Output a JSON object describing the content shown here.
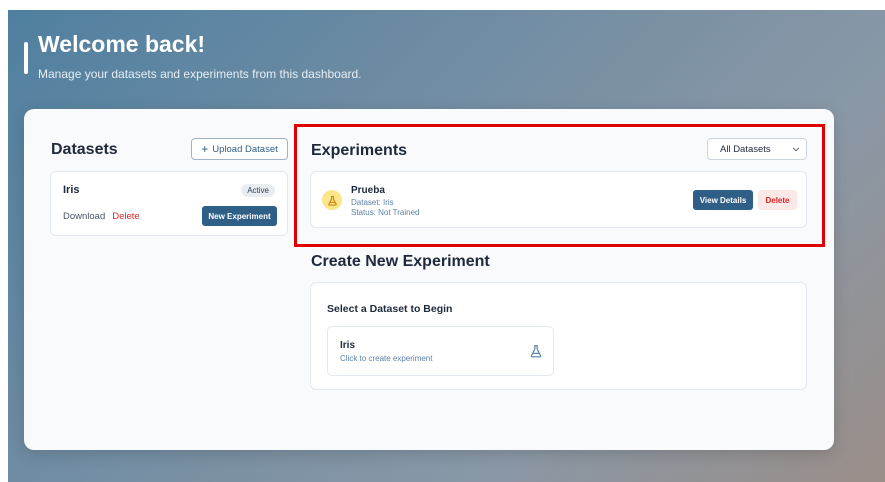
{
  "header": {
    "title": "Welcome back!",
    "subtitle": "Manage your datasets and experiments from this dashboard."
  },
  "datasets": {
    "title": "Datasets",
    "upload_label": "Upload Dataset",
    "items": [
      {
        "name": "Iris",
        "status": "Active",
        "download_label": "Download",
        "delete_label": "Delete",
        "new_experiment_label": "New Experiment"
      }
    ]
  },
  "experiments": {
    "title": "Experiments",
    "filter_selected": "All Datasets",
    "items": [
      {
        "name": "Prueba",
        "dataset_line": "Dataset: Iris",
        "status_line": "Status: Not Trained",
        "view_label": "View Details",
        "delete_label": "Delete"
      }
    ]
  },
  "create_experiment": {
    "title": "Create New Experiment",
    "prompt": "Select a Dataset to Begin",
    "options": [
      {
        "name": "Iris",
        "hint": "Click to create experiment"
      }
    ]
  },
  "colors": {
    "primary": "#2f5f86",
    "danger": "#dc2626",
    "highlight": "#e00000",
    "experiment_icon_bg": "#fbe58a"
  },
  "icons": {
    "upload": "plus-icon",
    "experiment": "flask-icon",
    "dataset_option": "flask-icon",
    "select": "chevron-down-icon"
  }
}
